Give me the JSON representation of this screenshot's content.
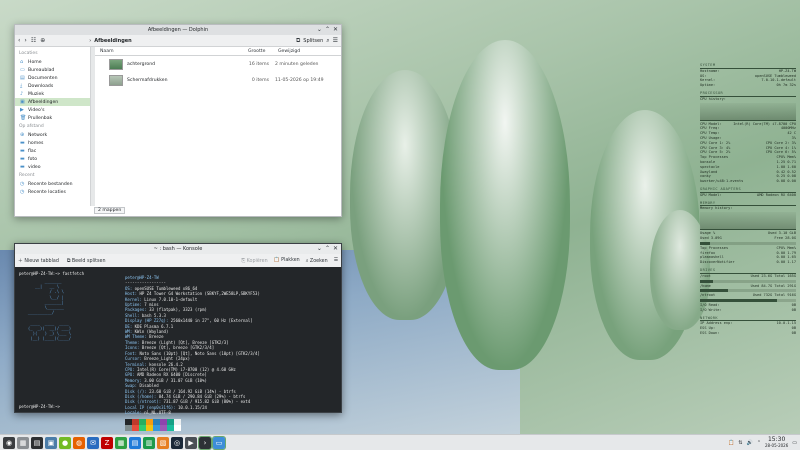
{
  "dolphin": {
    "title": "Afbeeldingen — Dolphin",
    "breadcrumb": "Afbeeldingen",
    "split_label": "Splitsen",
    "sidebar": [
      {
        "type": "header",
        "label": "Locaties"
      },
      {
        "type": "item",
        "label": "Home",
        "icon": "home-icon"
      },
      {
        "type": "item",
        "label": "Bureaublad",
        "icon": "desktop-icon"
      },
      {
        "type": "item",
        "label": "Documenten",
        "icon": "documents-icon"
      },
      {
        "type": "item",
        "label": "Downloads",
        "icon": "downloads-icon"
      },
      {
        "type": "item",
        "label": "Muziek",
        "icon": "music-icon"
      },
      {
        "type": "item",
        "label": "Afbeeldingen",
        "icon": "pictures-icon",
        "selected": true
      },
      {
        "type": "item",
        "label": "Video's",
        "icon": "videos-icon"
      },
      {
        "type": "item",
        "label": "Prullenbak",
        "icon": "trash-icon"
      },
      {
        "type": "header",
        "label": "Op afstand"
      },
      {
        "type": "item",
        "label": "Network",
        "icon": "network-icon"
      },
      {
        "type": "item",
        "label": "homes",
        "icon": "folder-icon"
      },
      {
        "type": "item",
        "label": "flac",
        "icon": "folder-icon"
      },
      {
        "type": "item",
        "label": "foto",
        "icon": "folder-icon"
      },
      {
        "type": "item",
        "label": "video",
        "icon": "folder-icon"
      },
      {
        "type": "header",
        "label": "Recent"
      },
      {
        "type": "item",
        "label": "Recente bestanden",
        "icon": "recent-files-icon"
      },
      {
        "type": "item",
        "label": "Recente locaties",
        "icon": "recent-locations-icon"
      }
    ],
    "columns": {
      "name": "Naam",
      "size": "Grootte",
      "modified": "Gewijzigd"
    },
    "files": [
      {
        "name": "achtergrond",
        "size": "16 items",
        "modified": "2 minuten geleden"
      },
      {
        "name": "Schermafdrukken",
        "size": "0 items",
        "modified": "11-05-2026 op 19:49"
      }
    ],
    "status": "2 mappen"
  },
  "konsole": {
    "title": "~ : bash — Konsole",
    "new_tab": "Nieuw tabblad",
    "split_view": "Beeld splitsen",
    "copy": "Kopiëren",
    "paste": "Plakken",
    "find": "Zoeken",
    "first_prompt": "peter@HP-Z4-TW:~> fastfetch",
    "user_host": "peter@HP-Z4-TW",
    "separator": "-----------------",
    "info": [
      {
        "k": "OS:",
        "v": "openSUSE Tumbleweed x86_64"
      },
      {
        "k": "Host:",
        "v": "HP Z4 Tower G4 Workstation (SBKYF,2WE58LP,SBKYF53)"
      },
      {
        "k": "Kernel:",
        "v": "Linux 7.0.10-1-default"
      },
      {
        "k": "Uptime:",
        "v": "7 mins"
      },
      {
        "k": "Packages:",
        "v": "33 (flatpak), 3323 (rpm)"
      },
      {
        "k": "Shell:",
        "v": "bash 5.3.3"
      },
      {
        "k": "Display (HP Z27q):",
        "v": "2560x1440 in 27\", 60 Hz [External]"
      },
      {
        "k": "DE:",
        "v": "KDE Plasma 6.7.1"
      },
      {
        "k": "WM:",
        "v": "KWin (Wayland)"
      },
      {
        "k": "WM Theme:",
        "v": "Breeze"
      },
      {
        "k": "Theme:",
        "v": "Breeze (Light) [Qt], Breeze [GTK2/3]"
      },
      {
        "k": "Icons:",
        "v": "Breeze [Qt], breeze [GTK2/3/4]"
      },
      {
        "k": "Font:",
        "v": "Noto Sans (10pt) [Qt], Noto Sans (10pt) [GTK2/3/4]"
      },
      {
        "k": "Cursor:",
        "v": "Breeze_Light (24px)"
      },
      {
        "k": "Terminal:",
        "v": "konsole 26.4.2"
      },
      {
        "k": "CPU:",
        "v": "Intel(R) Core(TM) i7-8700 (12) @ 4.60 GHz"
      },
      {
        "k": "GPU:",
        "v": "AMD Radeon RX 6400 [Discrete]"
      },
      {
        "k": "Memory:",
        "v": "3.00 GiB / 31.07 GiB (10%)"
      },
      {
        "k": "Swap:",
        "v": "Disabled"
      },
      {
        "k": "Disk (/):",
        "v": "23.60 GiB / 164.92 GiB (14%) - btrfs"
      },
      {
        "k": "Disk (/home):",
        "v": "84.74 GiB / 290.84 GiB (29%) - btrfs"
      },
      {
        "k": "Disk (/ntroot):",
        "v": "731.87 GiB / 915.82 GiB (80%) - ext4"
      },
      {
        "k": "Local IP (enp0s31f6):",
        "v": "10.0.1.15/24"
      },
      {
        "k": "Locale:",
        "v": "nl_NL.UTF-8"
      }
    ],
    "palette": [
      "#232629",
      "#c0392b",
      "#27ae60",
      "#f39c12",
      "#2980b9",
      "#8e44ad",
      "#16a085",
      "#ecf0f1",
      "#7f8c8d",
      "#e74c3c",
      "#2ecc71",
      "#f1c40f",
      "#3498db",
      "#9b59b6",
      "#1abc9c",
      "#ffffff"
    ],
    "last_prompt": "peter@HP-Z4-TW:~>"
  },
  "conky": {
    "system_hdr": "SYSTEM",
    "system": [
      [
        "Hostname:",
        "HP-Z4-TW"
      ],
      [
        "OS:",
        "openSUSE Tumbleweed"
      ],
      [
        "Kernel:",
        "7.0.10-1-default"
      ],
      [
        "Uptime:",
        "0h 7m 32s"
      ]
    ],
    "cpu_hdr": "PROCESSOR",
    "cpu_hist": "CPU history:",
    "cpu": [
      [
        "CPU Model:",
        "Intel(R) Core(TM) i7-8700 CPU"
      ],
      [
        "CPU Freq:",
        "4000MHz"
      ],
      [
        "CPU Temp:",
        "42 C"
      ],
      [
        "CPU Usage:",
        "3%"
      ]
    ],
    "cores": [
      [
        "CPU Core 1:",
        "2%",
        "CPU Core 2:",
        "3%"
      ],
      [
        "CPU Core 3:",
        "4%",
        "CPU Core 4:",
        "1%"
      ],
      [
        "CPU Core 5:",
        "2%",
        "CPU Core 6:",
        "5%"
      ]
    ],
    "top_hdr": [
      "Top Processes",
      "CPU% Mem%"
    ],
    "top": [
      [
        "konsole",
        "1.25",
        "0.71"
      ],
      [
        "spectacle",
        "1.00",
        "1.60"
      ],
      [
        "Xwayland",
        "0.42",
        "0.52"
      ],
      [
        "conky",
        "0.25",
        "0.08"
      ],
      [
        "kworker/u48:1-events",
        "0.08",
        "0.00"
      ]
    ],
    "gpu_hdr": "GRAPHIC ADAPTERS",
    "gpu": [
      "GPU Model:",
      "AMD Radeon RX 6400"
    ],
    "mem_hdr": "MEMORY",
    "mem_hist": "Memory history:",
    "mem": [
      [
        "Usage %",
        "Used 3.10 GiB"
      ],
      [
        "Used 3.09G",
        "Free 28.0G"
      ]
    ],
    "memtop_hdr": [
      "Top Processes",
      "CPU% Mem%"
    ],
    "memtop": [
      [
        "firefox",
        "0.00",
        "1.79"
      ],
      [
        "plasmashell",
        "0.00",
        "1.65"
      ],
      [
        "DiscoverNotifier",
        "0.00",
        "1.17"
      ]
    ],
    "drives_hdr": "DRIVES",
    "drives": [
      [
        "/root",
        "Used 23.6G Total 165G"
      ],
      [
        "/home",
        "Used 84.7G Total 291G"
      ],
      [
        "/ntroot",
        "Used 732G Total 916G"
      ]
    ],
    "drive_io": [
      [
        "I/O Read:",
        "0B"
      ],
      [
        "I/O Write:",
        "0B"
      ]
    ],
    "net_hdr": "NETWORK",
    "net": [
      [
        "IP Address enp:",
        "10.0.1.15"
      ],
      [
        "ESS Up:",
        "0B"
      ],
      [
        "ESS Down:",
        "0B"
      ]
    ]
  },
  "taskbar": {
    "time": "15:30",
    "date": "28-05-2026",
    "apps": [
      {
        "icon": "app-launcher-icon",
        "color": "#3a3d40"
      },
      {
        "icon": "pager-icon",
        "color": "#8a8e92"
      },
      {
        "icon": "system-monitor-icon",
        "color": "#2d2f31"
      },
      {
        "icon": "calculator-icon",
        "color": "#4c7da8"
      },
      {
        "icon": "opensuse-icon",
        "color": "#73ba25"
      },
      {
        "icon": "firefox-icon",
        "color": "#e66000"
      },
      {
        "icon": "thunderbird-icon",
        "color": "#2a6cbf"
      },
      {
        "icon": "filezilla-icon",
        "color": "#bf0000"
      },
      {
        "icon": "spreadsheet-icon",
        "color": "#2ea043"
      },
      {
        "icon": "document-icon",
        "color": "#1f7bd8"
      },
      {
        "icon": "sheets-icon",
        "color": "#1d9a4b"
      },
      {
        "icon": "presentation-icon",
        "color": "#e67e22"
      },
      {
        "icon": "steam-icon",
        "color": "#1b2838"
      },
      {
        "icon": "video-editor-icon",
        "color": "#4a4f55"
      },
      {
        "icon": "terminal-icon",
        "color": "#2d3136"
      },
      {
        "icon": "dolphin-icon",
        "color": "#3d8ed8"
      }
    ]
  }
}
